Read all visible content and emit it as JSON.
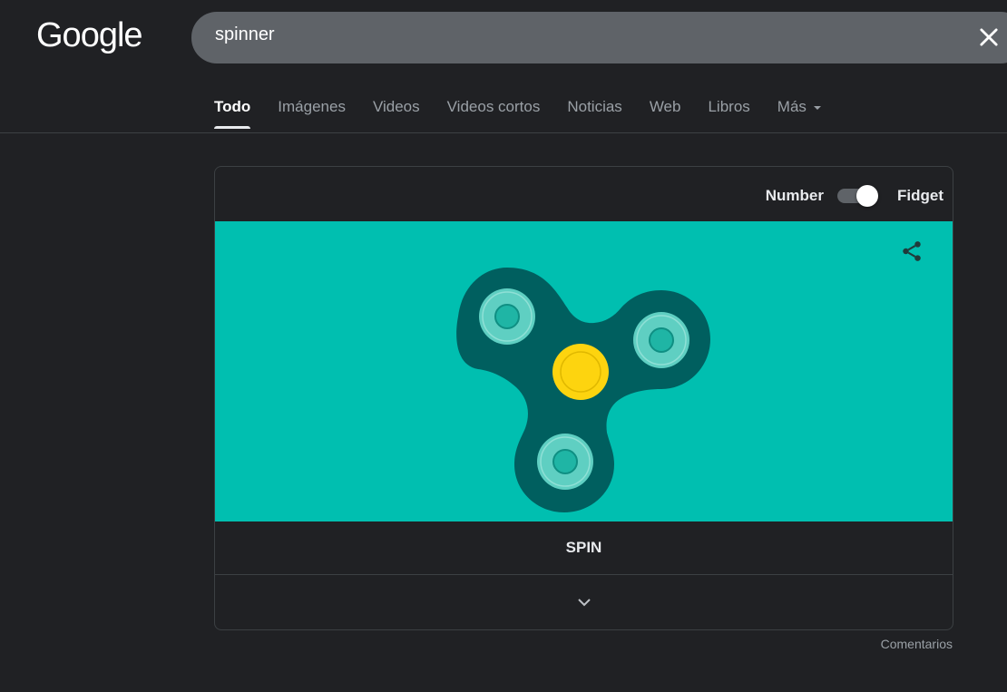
{
  "header": {
    "logo_text": "Google",
    "search_value": "spinner"
  },
  "tabs": [
    {
      "label": "Todo",
      "active": true
    },
    {
      "label": "Imágenes"
    },
    {
      "label": "Videos"
    },
    {
      "label": "Videos cortos"
    },
    {
      "label": "Noticias"
    },
    {
      "label": "Web"
    },
    {
      "label": "Libros"
    },
    {
      "label": "Más"
    }
  ],
  "widget": {
    "mode_left_label": "Number",
    "mode_right_label": "Fidget",
    "toggle_state": "Fidget",
    "spin_label": "SPIN",
    "colors": {
      "stage_bg": "#00bfb0",
      "spinner_body": "#005f5f",
      "bearing_outer": "#5fcfc2",
      "bearing_inner": "#1fb5a5",
      "center_cap": "#fdd40f",
      "center_ring": "#e0b800"
    },
    "icons": [
      "share-icon",
      "chevron-down-icon",
      "close-icon"
    ]
  },
  "footer": {
    "feedback_label": "Comentarios"
  }
}
